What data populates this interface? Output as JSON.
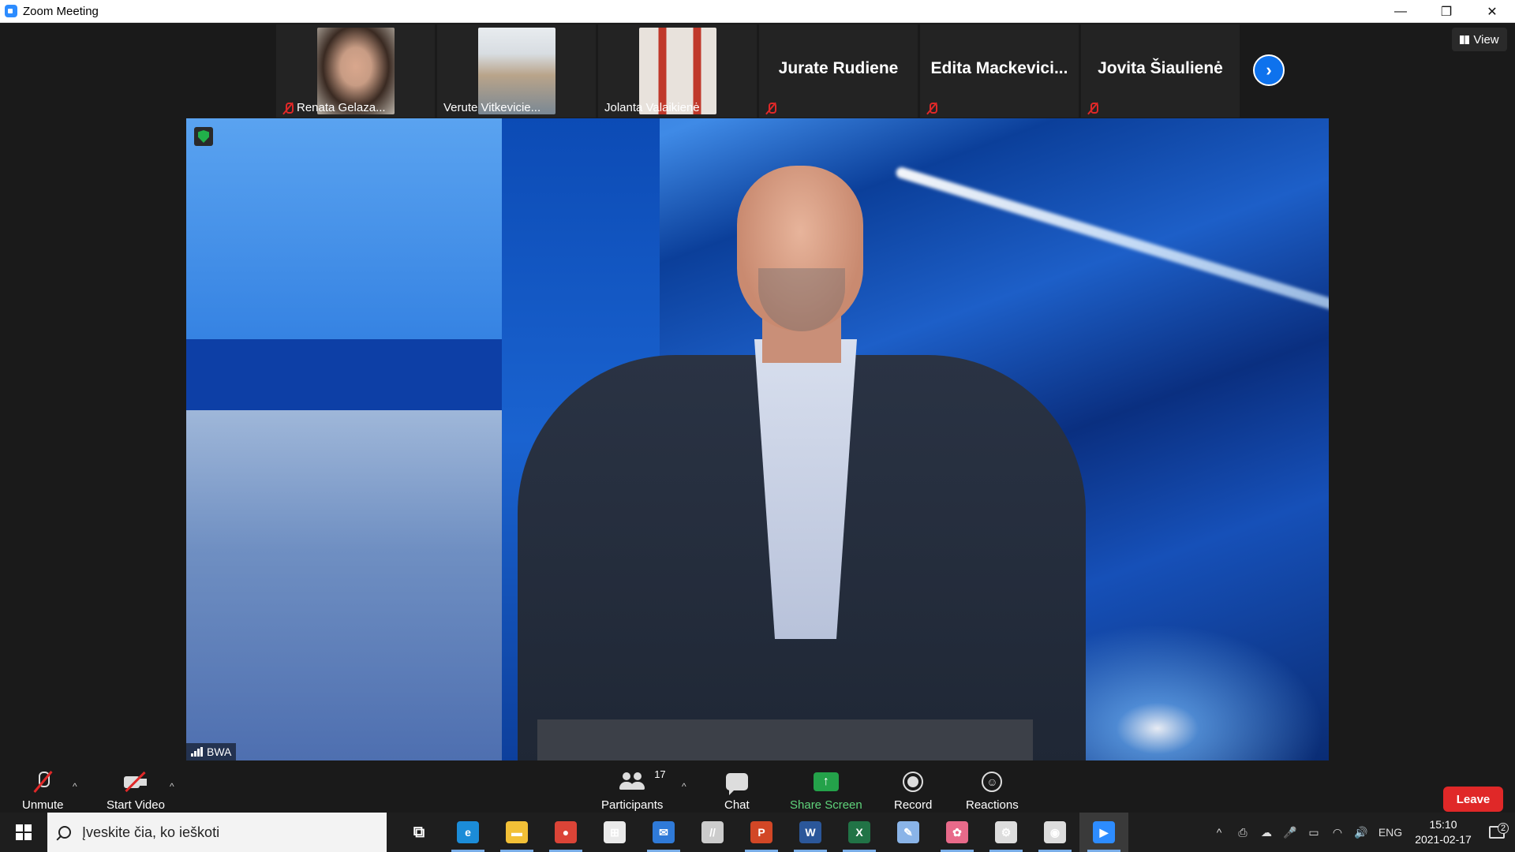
{
  "window": {
    "title": "Zoom Meeting",
    "controls": [
      "—",
      "❐",
      "✕"
    ]
  },
  "participants_strip": [
    {
      "name": "Renata Gelaza...",
      "has_video": true,
      "muted": true,
      "photo_colors": [
        "#c89c84",
        "#3a2a22"
      ]
    },
    {
      "name": "Verute Vitkevicie...",
      "has_video": true,
      "muted": false,
      "photo_colors": [
        "#d8dde2",
        "#7a8894"
      ]
    },
    {
      "name": "Jolanta Valaikienė",
      "has_video": true,
      "muted": false,
      "photo_colors": [
        "#c0392b",
        "#e8e2dc"
      ]
    },
    {
      "name": "Jurate Rudiene",
      "has_video": false,
      "muted": true
    },
    {
      "name": "Edita  Mackevici...",
      "has_video": false,
      "muted": true
    },
    {
      "name": "Jovita Šiaulienė",
      "has_video": false,
      "muted": true
    }
  ],
  "next_page_icon": "chevron-right-icon",
  "view_button": {
    "label": "View",
    "icon": "grid-icon"
  },
  "main_video": {
    "speaker_label": "BWA",
    "secure_icon": "shield-check-icon"
  },
  "toolbar": {
    "unmute": {
      "label": "Unmute",
      "icon": "mic-muted-icon"
    },
    "start_video": {
      "label": "Start Video",
      "icon": "camera-off-icon"
    },
    "participants": {
      "label": "Participants",
      "count": "17",
      "icon": "people-icon"
    },
    "chat": {
      "label": "Chat",
      "icon": "chat-icon"
    },
    "share_screen": {
      "label": "Share Screen",
      "icon": "share-screen-icon",
      "color": "#24a24a"
    },
    "record": {
      "label": "Record",
      "icon": "record-icon"
    },
    "reactions": {
      "label": "Reactions",
      "icon": "smiley-icon"
    },
    "leave": {
      "label": "Leave",
      "color": "#e02828"
    },
    "caret": "^"
  },
  "taskbar": {
    "search_placeholder": "Įveskite čia, ko ieškoti",
    "apps": [
      {
        "name": "task-view",
        "glyph": "⧉"
      },
      {
        "name": "edge",
        "glyph": "e",
        "color": "#1b8cd8"
      },
      {
        "name": "file-explorer",
        "glyph": "▬",
        "color": "#f2c037"
      },
      {
        "name": "chrome",
        "glyph": "●",
        "color": "#db4437"
      },
      {
        "name": "store",
        "glyph": "⊞",
        "color": "#eaeaea"
      },
      {
        "name": "mail",
        "glyph": "✉",
        "color": "#2f7ad8"
      },
      {
        "name": "app-slash",
        "glyph": "//",
        "color": "#cccccc"
      },
      {
        "name": "powerpoint",
        "glyph": "P",
        "color": "#d24726"
      },
      {
        "name": "word",
        "glyph": "W",
        "color": "#2b579a"
      },
      {
        "name": "excel",
        "glyph": "X",
        "color": "#217346"
      },
      {
        "name": "paint",
        "glyph": "✎",
        "color": "#8ab4e8"
      },
      {
        "name": "paint-3d",
        "glyph": "✿",
        "color": "#e86a8a"
      },
      {
        "name": "settings",
        "glyph": "⚙",
        "color": "#dddddd"
      },
      {
        "name": "camera-app",
        "glyph": "◉",
        "color": "#dddddd"
      },
      {
        "name": "zoom",
        "glyph": "▶",
        "color": "#2d8cff"
      }
    ],
    "tray": {
      "icons": [
        "^",
        "⎙",
        "☁",
        "🎤",
        "▭",
        "◠",
        "🔊"
      ],
      "language": "ENG",
      "time": "15:10",
      "date": "2021-02-17",
      "notifications_count": "2"
    }
  }
}
